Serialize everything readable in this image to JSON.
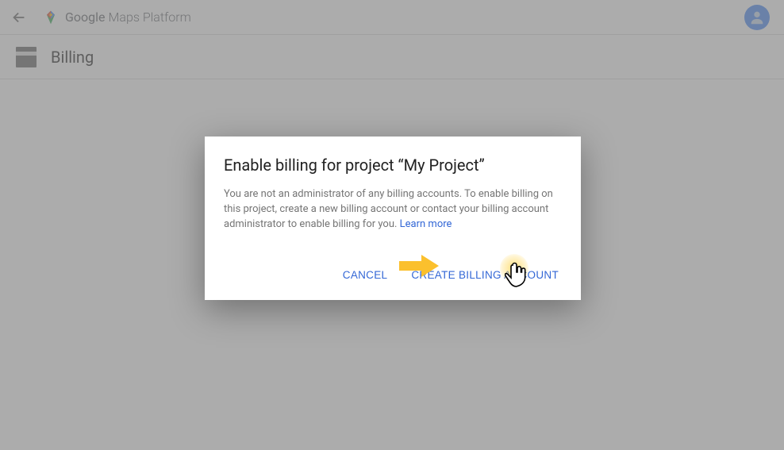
{
  "header": {
    "brand_google": "Google",
    "brand_platform": "Maps Platform"
  },
  "subheader": {
    "title": "Billing"
  },
  "dialog": {
    "title": "Enable billing for project “My Project”",
    "body": "You are not an administrator of any billing accounts. To enable billing on this project, create a new billing account or contact your billing account administrator to enable billing for you. ",
    "learn_more": "Learn more",
    "cancel": "Cancel",
    "create": "Create Billing Account"
  }
}
